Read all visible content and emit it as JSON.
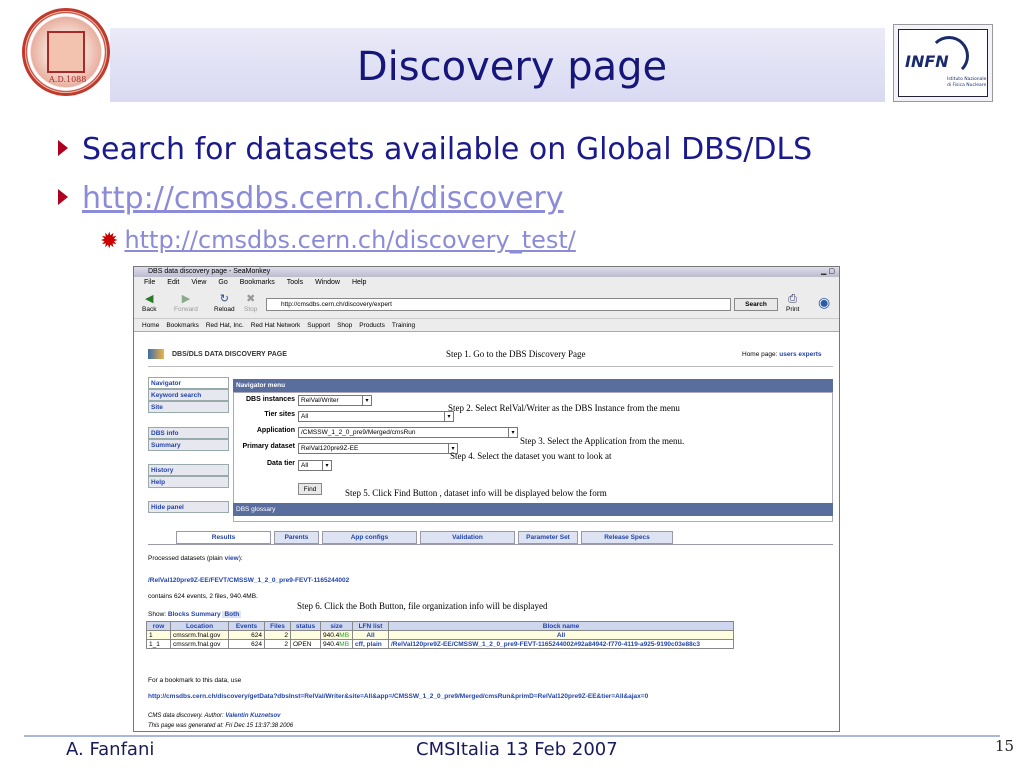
{
  "slide": {
    "title": "Discovery page",
    "bullet1": "Search for datasets available on Global DBS/DLS",
    "bullet2": "http://cmsdbs.cern.ch/discovery",
    "sub_bullet": "http://cmsdbs.cern.ch/discovery_test/",
    "footer_left": "A. Fanfani",
    "footer_center": "CMSItalia 13 Feb 2007",
    "page_number": "15",
    "infn_word": "INFN",
    "infn_sub1": "Istituto Nazionale",
    "infn_sub2": "di Fisica Nucleare",
    "seal_text": "A.D.1088"
  },
  "browser": {
    "window_title": "DBS data discovery page - SeaMonkey",
    "menu": [
      "File",
      "Edit",
      "View",
      "Go",
      "Bookmarks",
      "Tools",
      "Window",
      "Help"
    ],
    "nav": {
      "back": "Back",
      "forward": "Forward",
      "reload": "Reload",
      "stop": "Stop",
      "print": "Print"
    },
    "url": "http://cmsdbs.cern.ch/discovery/expert",
    "search_label": "Search",
    "bookmarks": [
      "Home",
      "Bookmarks",
      "Red Hat, Inc.",
      "Red Hat Network",
      "Support",
      "Shop",
      "Products",
      "Training"
    ]
  },
  "page": {
    "header": "DBS/DLS DATA DISCOVERY PAGE",
    "home_prefix": "Home page:",
    "home_links": "users experts",
    "sidebar": [
      "Navigator",
      "Keyword search",
      "Site",
      "DBS info",
      "Summary",
      "History",
      "Help",
      "Hide panel"
    ],
    "nav_menu": "Navigator menu",
    "labels": {
      "instances": "DBS instances",
      "tier_sites": "Tier sites",
      "application": "Application",
      "primary": "Primary dataset",
      "data_tier": "Data tier"
    },
    "values": {
      "instances": "RelVal/Writer",
      "tier_sites": "All",
      "application": "/CMSSW_1_2_0_pre9/Merged/cmsRun",
      "primary": "RelVal120pre9Z-EE",
      "data_tier": "All"
    },
    "find_label": "Find",
    "glossary": "DBS glossary",
    "tabs": [
      "Results",
      "Parents",
      "App configs",
      "Validation",
      "Parameter Set",
      "Release Specs"
    ],
    "processed_prefix": "Processed datasets (plain",
    "processed_view": "view",
    "processed_suffix": "):",
    "dataset_path": "/RelVal120pre9Z-EE/FEVT/CMSSW_1_2_0_pre9-FEVT-1165244002",
    "contains": "contains 624 events, 2 files, 940.4MB.",
    "show_label": "Show:",
    "show_opts": [
      "Blocks",
      "Summary",
      "Both"
    ],
    "table": {
      "headers": [
        "row",
        "Location",
        "Events",
        "Files",
        "status",
        "size",
        "LFN list",
        "Block name"
      ],
      "rows": [
        [
          "1",
          "cmssrm.fnal.gov",
          "624",
          "2",
          "",
          "940.4",
          "MB",
          "All",
          "All"
        ],
        [
          "1_1",
          "cmssrm.fnal.gov",
          "624",
          "2",
          "OPEN",
          "940.4",
          "MB",
          "cff, plain",
          "/RelVal120pre9Z-EE/CMSSW_1_2_0_pre9-FEVT-1165244002#92a84942-f770-4119-a925-9190c03e88c3"
        ]
      ]
    },
    "bookmark_text": "For a bookmark to this data, use",
    "bookmark_url": "http://cmsdbs.cern.ch/discovery/getData?dbsInst=RelVal/Writer&site=All&app=/CMSSW_1_2_0_pre9/Merged/cmsRun&primD=RelVal120pre9Z-EE&tier=All&ajax=0",
    "author_prefix": "CMS data discovery. Author:",
    "author": "Valentin Kuznetsov",
    "generated": "This page was generated at: Fri Dec 15 13:37:38 2006"
  },
  "steps": {
    "s1": "Step 1. Go to the DBS Discovery Page",
    "s2": "Step 2. Select RelVal/Writer as the DBS Instance from the menu",
    "s3": "Step 3. Select the Application from the menu.",
    "s4": "Step 4. Select the dataset you want to look at",
    "s5": "Step 5.  Click Find Button , dataset info will be displayed below the form",
    "s6": "Step 6. Click the Both Button, file organization info will be displayed"
  }
}
